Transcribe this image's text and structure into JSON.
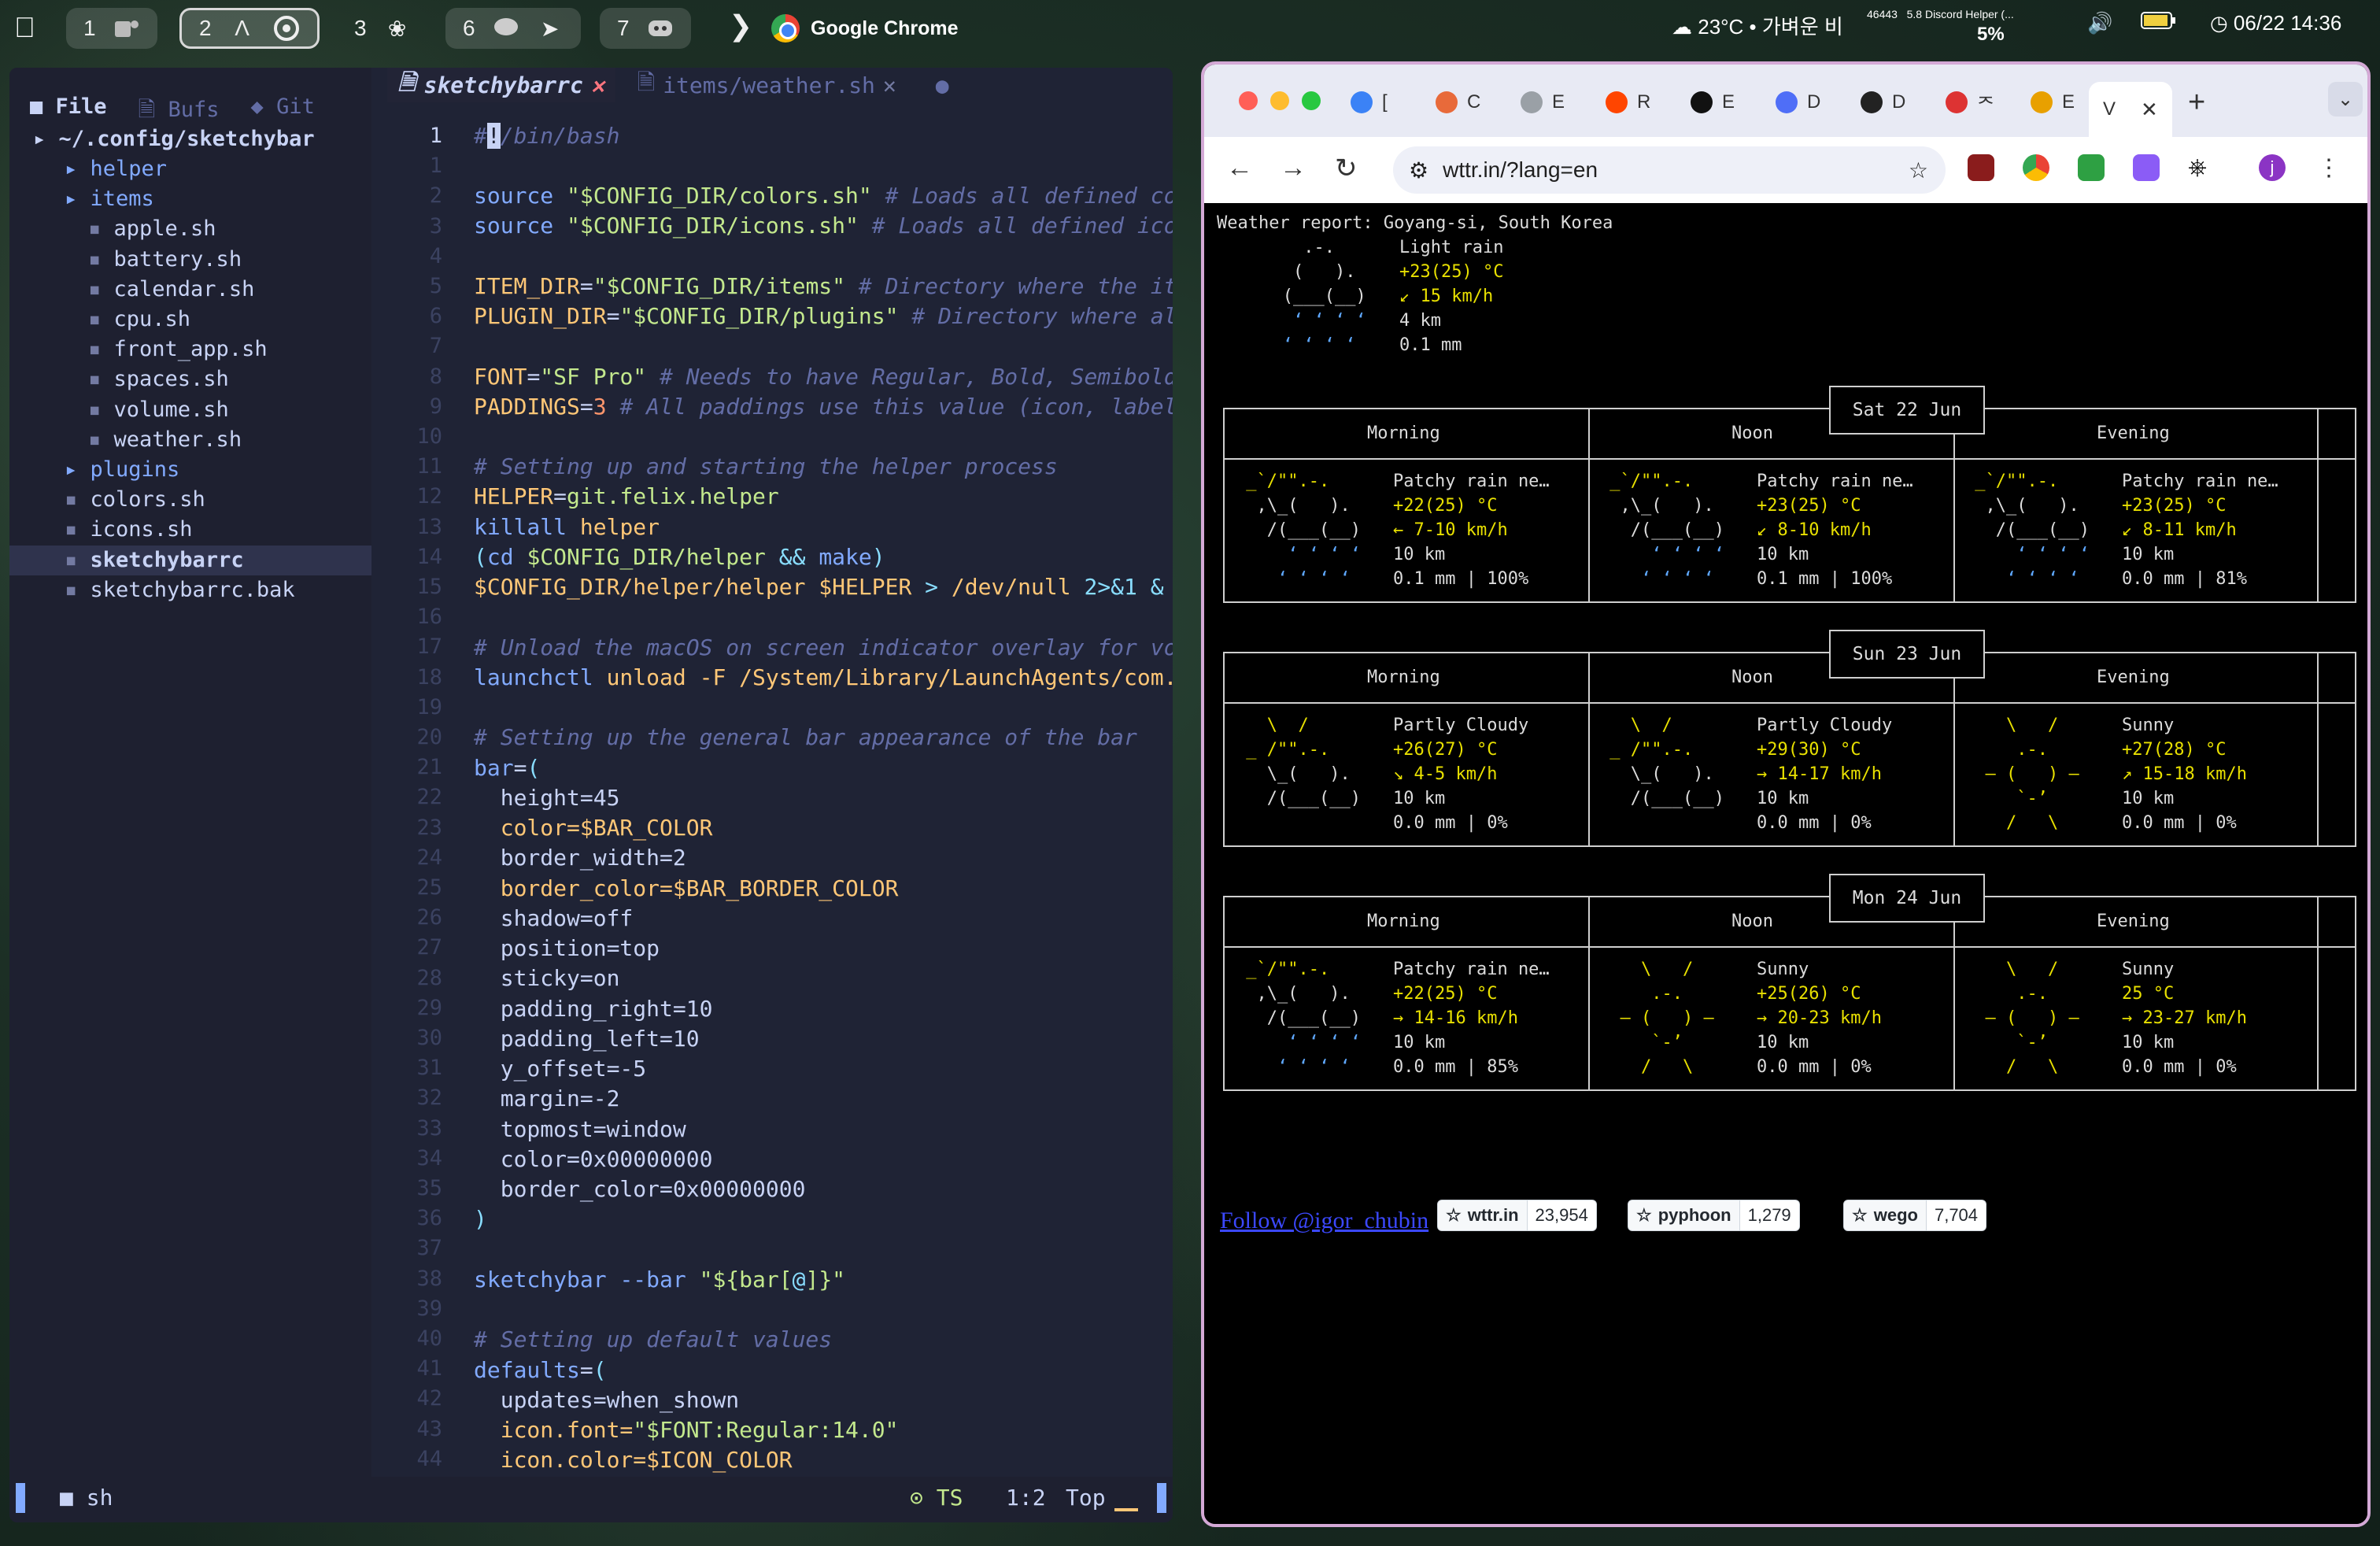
{
  "menubar": {
    "workspaces": [
      "1",
      "2",
      "3",
      "6",
      "7"
    ],
    "active_app": "Google Chrome",
    "weather": "23°C • 가벼운 비",
    "cpu_label": "46443",
    "cpu_process": "5.8 Discord Helper (...",
    "cpu_percent": "5%",
    "clock": "06/22 14:36"
  },
  "tree": {
    "tabs": [
      "File",
      "Bufs",
      "Git"
    ],
    "root": "~/.config/sketchybar",
    "rows": [
      {
        "label": "helper",
        "type": "dir"
      },
      {
        "label": "items",
        "type": "dir"
      },
      {
        "label": "apple.sh",
        "type": "file"
      },
      {
        "label": "battery.sh",
        "type": "file"
      },
      {
        "label": "calendar.sh",
        "type": "file"
      },
      {
        "label": "cpu.sh",
        "type": "file"
      },
      {
        "label": "front_app.sh",
        "type": "file"
      },
      {
        "label": "spaces.sh",
        "type": "file"
      },
      {
        "label": "volume.sh",
        "type": "file"
      },
      {
        "label": "weather.sh",
        "type": "file"
      },
      {
        "label": "plugins",
        "type": "dir"
      },
      {
        "label": "colors.sh",
        "type": "file"
      },
      {
        "label": "icons.sh",
        "type": "file"
      },
      {
        "label": "sketchybarrc",
        "type": "file"
      },
      {
        "label": "sketchybarrc.bak",
        "type": "file"
      }
    ]
  },
  "editor": {
    "tabs": [
      {
        "label": "sketchybarrc",
        "active": true
      },
      {
        "label": "items/weather.sh",
        "active": false
      }
    ],
    "line_numbers": [
      "1",
      "1",
      "2",
      "3",
      "4",
      "5",
      "6",
      "7",
      "8",
      "9",
      "10",
      "11",
      "12",
      "13",
      "14",
      "15",
      "16",
      "17",
      "18",
      "19",
      "20",
      "21",
      "22",
      "23",
      "24",
      "25",
      "26",
      "27",
      "28",
      "29",
      "30",
      "31",
      "32",
      "33",
      "34",
      "35",
      "36",
      "37",
      "38",
      "39",
      "40",
      "41",
      "42",
      "43",
      "44"
    ],
    "status": {
      "mode": "sh",
      "lsp": "TS",
      "position": "1:2",
      "scroll": "Top"
    }
  },
  "chrome": {
    "tab_initials": [
      "[",
      "C",
      "E",
      "R",
      "E",
      "D",
      "D",
      "ᄌ",
      "E"
    ],
    "active_tab": "V",
    "url": "wttr.in/?lang=en",
    "profile_initial": "j"
  },
  "wttr": {
    "report_title": "Weather report: Goyang-si, South Korea",
    "current": {
      "art": [
        "     .-.   ",
        "    (   ). ",
        "   (___(__)",
        "    ‘ ‘ ‘ ‘",
        "   ‘ ‘ ‘ ‘ "
      ],
      "condition": "Light rain",
      "temp": "+23(25) °C",
      "wind": "↙ 15 km/h",
      "visibility": "4 km",
      "precip": "0.1 mm"
    },
    "columns": [
      "Morning",
      "Noon",
      "Evening"
    ],
    "days": [
      {
        "date": "Sat 22 Jun",
        "cells": [
          {
            "art": [
              " _`/\"\".-.  ",
              "  ,\\_(   ). ",
              "   /(___(__)",
              "     ‘ ‘ ‘ ‘",
              "    ‘ ‘ ‘ ‘ "
            ],
            "cond": "Patchy rain ne…",
            "temp": "+22(25) °C",
            "wind": "← 7-10 km/h",
            "vis": "10 km",
            "precip": "0.1 mm | 100%"
          },
          {
            "art": [
              " _`/\"\".-.  ",
              "  ,\\_(   ). ",
              "   /(___(__)",
              "     ‘ ‘ ‘ ‘",
              "    ‘ ‘ ‘ ‘ "
            ],
            "cond": "Patchy rain ne…",
            "temp": "+23(25) °C",
            "wind": "↙ 8-10 km/h",
            "vis": "10 km",
            "precip": "0.1 mm | 100%"
          },
          {
            "art": [
              " _`/\"\".-.  ",
              "  ,\\_(   ). ",
              "   /(___(__)",
              "     ‘ ‘ ‘ ‘",
              "    ‘ ‘ ‘ ‘ "
            ],
            "cond": "Patchy rain ne…",
            "temp": "+23(25) °C",
            "wind": "↙ 8-11 km/h",
            "vis": "10 km",
            "precip": "0.0 mm | 81%"
          }
        ]
      },
      {
        "date": "Sun 23 Jun",
        "cells": [
          {
            "art": [
              "   \\  /     ",
              " _ /\"\".-.   ",
              "   \\_(   ). ",
              "   /(___(__)",
              "            "
            ],
            "cond": "Partly Cloudy",
            "temp": "+26(27) °C",
            "wind": "↘ 4-5 km/h",
            "vis": "10 km",
            "precip": "0.0 mm | 0%"
          },
          {
            "art": [
              "   \\  /     ",
              " _ /\"\".-.   ",
              "   \\_(   ). ",
              "   /(___(__)",
              "            "
            ],
            "cond": "Partly Cloudy",
            "temp": "+29(30) °C",
            "wind": "→ 14-17 km/h",
            "vis": "10 km",
            "precip": "0.0 mm | 0%"
          },
          {
            "art": [
              "    \\   /   ",
              "     .-.    ",
              "  ― (   ) ― ",
              "     `-’    ",
              "    /   \\   "
            ],
            "cond": "Sunny",
            "temp": "+27(28) °C",
            "wind": "↗ 15-18 km/h",
            "vis": "10 km",
            "precip": "0.0 mm | 0%"
          }
        ]
      },
      {
        "date": "Mon 24 Jun",
        "cells": [
          {
            "art": [
              " _`/\"\".-.  ",
              "  ,\\_(   ). ",
              "   /(___(__)",
              "     ‘ ‘ ‘ ‘",
              "    ‘ ‘ ‘ ‘ "
            ],
            "cond": "Patchy rain ne…",
            "temp": "+22(25) °C",
            "wind": "→ 14-16 km/h",
            "vis": "10 km",
            "precip": "0.0 mm | 85%"
          },
          {
            "art": [
              "    \\   /   ",
              "     .-.    ",
              "  ― (   ) ― ",
              "     `-’    ",
              "    /   \\   "
            ],
            "cond": "Sunny",
            "temp": "+25(26) °C",
            "wind": "→ 20-23 km/h",
            "vis": "10 km",
            "precip": "0.0 mm | 0%"
          },
          {
            "art": [
              "    \\   /   ",
              "     .-.    ",
              "  ― (   ) ― ",
              "     `-’    ",
              "    /   \\   "
            ],
            "cond": "Sunny",
            "temp": "25 °C",
            "wind": "→ 23-27 km/h",
            "vis": "10 km",
            "precip": "0.0 mm | 0%"
          }
        ]
      }
    ],
    "follow_link": "Follow @igor_chubin",
    "stars": [
      {
        "name": "wttr.in",
        "count": "23,954"
      },
      {
        "name": "pyphoon",
        "count": "1,279"
      },
      {
        "name": "wego",
        "count": "7,704"
      }
    ]
  }
}
